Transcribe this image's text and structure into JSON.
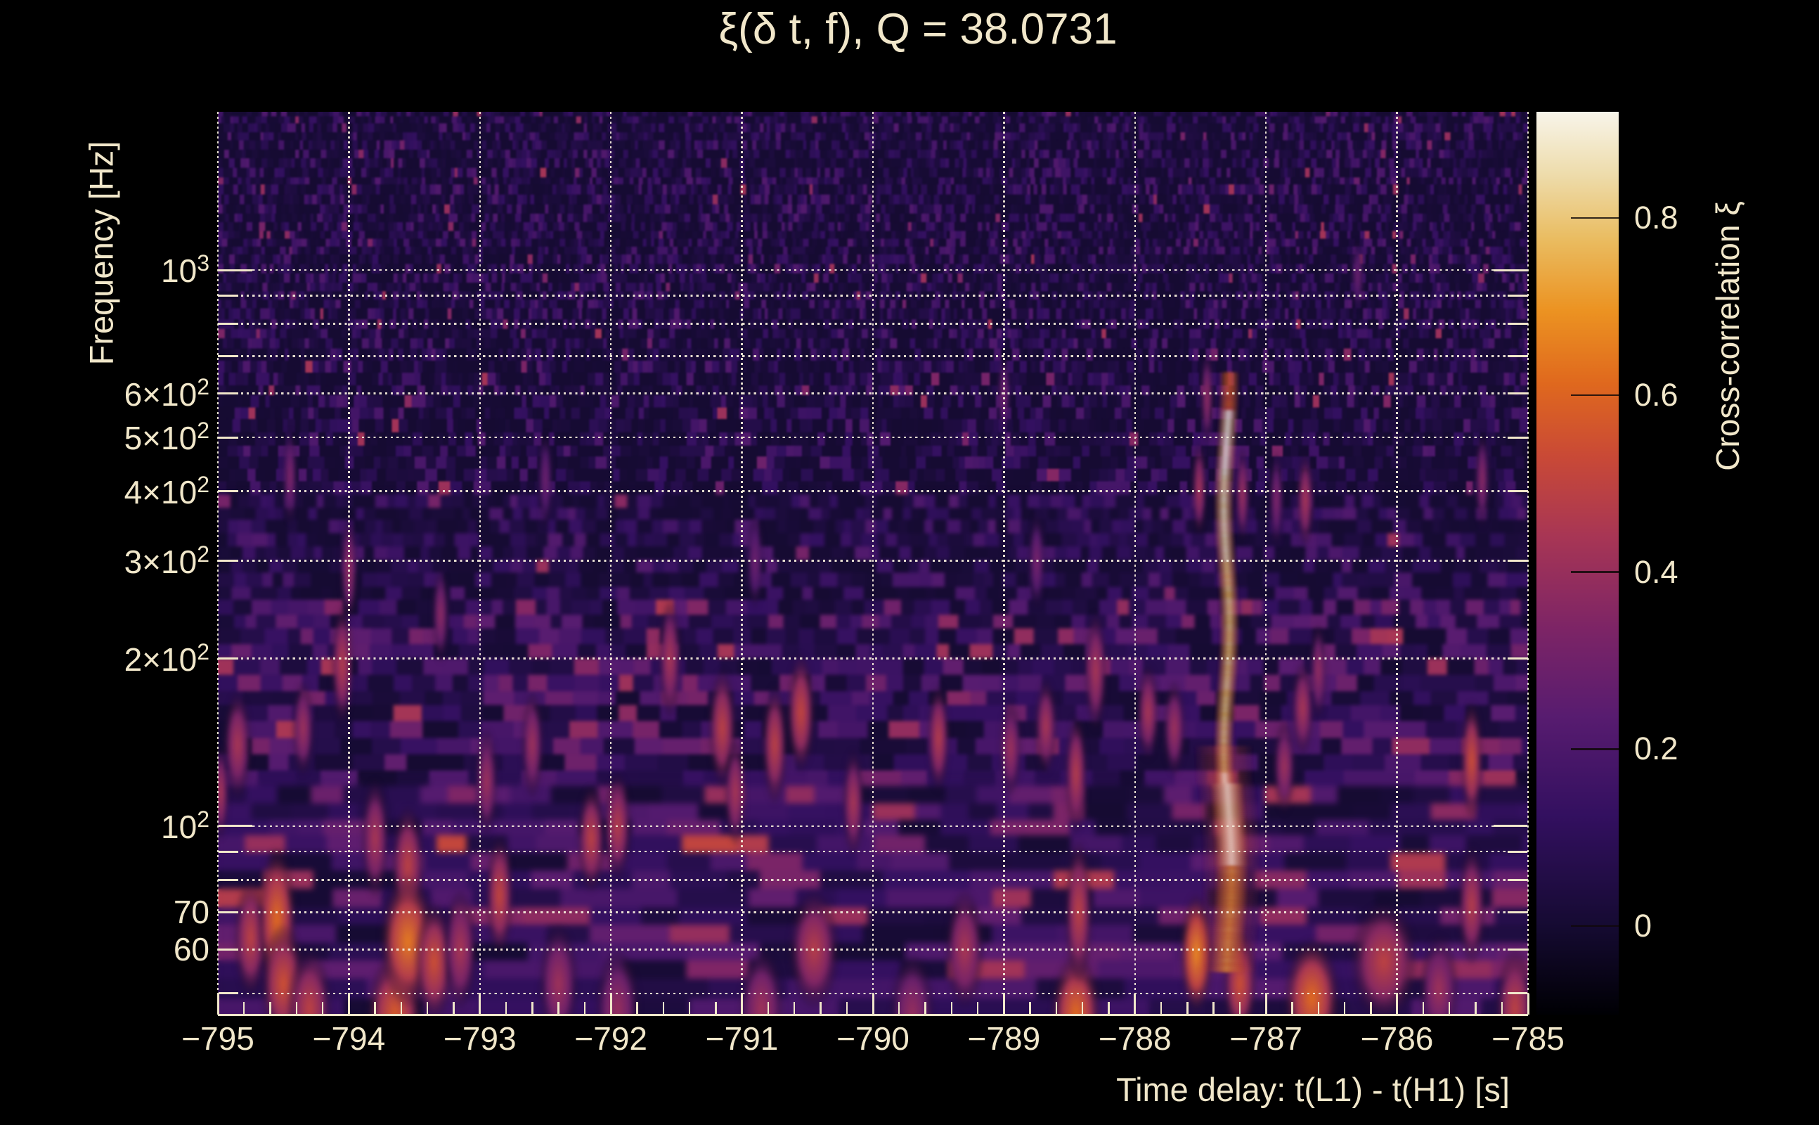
{
  "title": "ξ(δ t, f), Q = 38.0731",
  "colors": {
    "background": "#000000",
    "text": "#f1e7ca",
    "grid": "#f7efdc"
  },
  "axes": {
    "x": {
      "title": "Time delay: t(L1) - t(H1) [s]",
      "range": [
        -795,
        -785
      ],
      "minor_tick_step": 0.2,
      "ticks": [
        {
          "value": -795,
          "label": "−795"
        },
        {
          "value": -794,
          "label": "−794"
        },
        {
          "value": -793,
          "label": "−793"
        },
        {
          "value": -792,
          "label": "−792"
        },
        {
          "value": -791,
          "label": "−791"
        },
        {
          "value": -790,
          "label": "−790"
        },
        {
          "value": -789,
          "label": "−789"
        },
        {
          "value": -788,
          "label": "−788"
        },
        {
          "value": -787,
          "label": "−787"
        },
        {
          "value": -786,
          "label": "−786"
        },
        {
          "value": -785,
          "label": "−785"
        }
      ]
    },
    "y": {
      "title": "Frequency [Hz]",
      "scale": "log",
      "range_hz": [
        45.8,
        1926
      ],
      "gridlines_hz": [
        50,
        60,
        70,
        80,
        90,
        100,
        200,
        300,
        400,
        500,
        600,
        700,
        800,
        900,
        1000
      ],
      "ticks": [
        {
          "value": 1000,
          "base": "10",
          "sup": "3"
        },
        {
          "value": 600,
          "base": "6×10",
          "sup": "2"
        },
        {
          "value": 500,
          "base": "5×10",
          "sup": "2"
        },
        {
          "value": 400,
          "base": "4×10",
          "sup": "2"
        },
        {
          "value": 300,
          "base": "3×10",
          "sup": "2"
        },
        {
          "value": 200,
          "base": "2×10",
          "sup": "2"
        },
        {
          "value": 100,
          "base": "10",
          "sup": "2"
        },
        {
          "value": 70,
          "base": "70",
          "sup": ""
        },
        {
          "value": 60,
          "base": "60",
          "sup": ""
        }
      ]
    },
    "colorbar": {
      "title": "Cross-correlation ξ",
      "range": [
        -0.1,
        0.92
      ],
      "ticks": [
        {
          "value": 0.8,
          "label": "0.8"
        },
        {
          "value": 0.6,
          "label": "0.6"
        },
        {
          "value": 0.4,
          "label": "0.4"
        },
        {
          "value": 0.2,
          "label": "0.2"
        },
        {
          "value": 0,
          "label": "0"
        }
      ]
    }
  },
  "chart_data": {
    "type": "heatmap",
    "title": "ξ(δ t, f), Q = 38.0731",
    "q_value": 38.0731,
    "xlabel": "Time delay: t(L1) - t(H1) [s]",
    "ylabel": "Frequency [Hz]",
    "zlabel": "Cross-correlation ξ",
    "x_range": [
      -795,
      -785
    ],
    "y_range_hz": [
      45.8,
      1926
    ],
    "y_scale": "log",
    "z_range": [
      -0.1,
      0.92
    ],
    "legend_position": "right-colorbar",
    "grid": "dotted-white-at-decade-subdivisions",
    "colormap_stops": [
      [
        0.0,
        "#000004"
      ],
      [
        0.1,
        "#160b33"
      ],
      [
        0.22,
        "#331060"
      ],
      [
        0.33,
        "#581c70"
      ],
      [
        0.43,
        "#7e2566"
      ],
      [
        0.53,
        "#a83655"
      ],
      [
        0.62,
        "#ca4a36"
      ],
      [
        0.7,
        "#e0691e"
      ],
      [
        0.78,
        "#ec9322"
      ],
      [
        0.86,
        "#eabd62"
      ],
      [
        0.93,
        "#eedcab"
      ],
      [
        1.0,
        "#f8f5ea"
      ]
    ],
    "noise": {
      "seed": 1234,
      "base_level": 0.1,
      "low_freq_boost": 0.3,
      "texture": "fine-vertical-striations-above-600Hz, coarse-blobs-below-200Hz"
    },
    "streak": {
      "t": -787.3,
      "f_min": 55,
      "f_max": 660,
      "width_s": 0.035,
      "segments": [
        [
          55,
          85,
          0.7
        ],
        [
          85,
          125,
          0.95
        ],
        [
          125,
          300,
          0.8
        ],
        [
          300,
          430,
          0.87
        ],
        [
          430,
          560,
          0.94
        ],
        [
          560,
          660,
          0.55
        ]
      ]
    },
    "blobs": [
      [
        -794.98,
        115,
        0.45,
        0.03,
        0.04
      ],
      [
        -794.85,
        140,
        0.45,
        0.05,
        0.045
      ],
      [
        -794.75,
        63,
        0.5,
        0.06,
        0.05
      ],
      [
        -794.55,
        68,
        0.62,
        0.07,
        0.06
      ],
      [
        -794.5,
        52,
        0.55,
        0.08,
        0.05
      ],
      [
        -794.35,
        150,
        0.42,
        0.04,
        0.04
      ],
      [
        -794.3,
        47,
        0.5,
        0.08,
        0.05
      ],
      [
        -794.45,
        425,
        0.35,
        0.025,
        0.04
      ],
      [
        -794.05,
        195,
        0.48,
        0.04,
        0.05
      ],
      [
        -794.0,
        290,
        0.4,
        0.03,
        0.045
      ],
      [
        -793.8,
        95,
        0.45,
        0.05,
        0.05
      ],
      [
        -793.65,
        46,
        0.58,
        0.1,
        0.05
      ],
      [
        -793.55,
        85,
        0.5,
        0.06,
        0.05
      ],
      [
        -793.55,
        62,
        0.65,
        0.1,
        0.055
      ],
      [
        -793.35,
        57,
        0.55,
        0.07,
        0.05
      ],
      [
        -793.3,
        240,
        0.38,
        0.03,
        0.04
      ],
      [
        -793.15,
        60,
        0.45,
        0.06,
        0.05
      ],
      [
        -792.95,
        120,
        0.42,
        0.04,
        0.045
      ],
      [
        -792.85,
        75,
        0.52,
        0.05,
        0.05
      ],
      [
        -792.6,
        140,
        0.42,
        0.04,
        0.045
      ],
      [
        -792.5,
        420,
        0.3,
        0.025,
        0.04
      ],
      [
        -792.4,
        52,
        0.42,
        0.07,
        0.05
      ],
      [
        -792.15,
        95,
        0.5,
        0.05,
        0.045
      ],
      [
        -791.95,
        100,
        0.48,
        0.05,
        0.045
      ],
      [
        -791.95,
        47,
        0.4,
        0.08,
        0.05
      ],
      [
        -791.55,
        200,
        0.45,
        0.04,
        0.05
      ],
      [
        -791.15,
        150,
        0.5,
        0.05,
        0.05
      ],
      [
        -791.05,
        115,
        0.45,
        0.04,
        0.045
      ],
      [
        -790.9,
        300,
        0.3,
        0.03,
        0.04
      ],
      [
        -790.85,
        47,
        0.42,
        0.08,
        0.05
      ],
      [
        -790.75,
        140,
        0.5,
        0.045,
        0.05
      ],
      [
        -790.55,
        160,
        0.52,
        0.05,
        0.05
      ],
      [
        -790.45,
        60,
        0.48,
        0.09,
        0.05
      ],
      [
        -790.15,
        110,
        0.45,
        0.04,
        0.045
      ],
      [
        -789.7,
        46,
        0.4,
        0.08,
        0.05
      ],
      [
        -789.5,
        144,
        0.48,
        0.04,
        0.045
      ],
      [
        -789.3,
        60,
        0.45,
        0.07,
        0.05
      ],
      [
        -789.0,
        600,
        0.33,
        0.02,
        0.035
      ],
      [
        -788.95,
        138,
        0.42,
        0.04,
        0.04
      ],
      [
        -788.75,
        300,
        0.33,
        0.03,
        0.04
      ],
      [
        -788.68,
        151,
        0.45,
        0.04,
        0.04
      ],
      [
        -788.45,
        46,
        0.62,
        0.09,
        0.05
      ],
      [
        -788.43,
        70,
        0.5,
        0.05,
        0.06
      ],
      [
        -788.45,
        124,
        0.48,
        0.04,
        0.05
      ],
      [
        -788.3,
        190,
        0.45,
        0.04,
        0.05
      ],
      [
        -787.9,
        160,
        0.45,
        0.04,
        0.04
      ],
      [
        -787.7,
        150,
        0.42,
        0.04,
        0.04
      ],
      [
        -787.53,
        59,
        0.68,
        0.06,
        0.05
      ],
      [
        -787.51,
        404,
        0.45,
        0.025,
        0.04
      ],
      [
        -787.45,
        590,
        0.4,
        0.022,
        0.04
      ],
      [
        -787.2,
        52,
        0.55,
        0.06,
        0.045
      ],
      [
        -787.18,
        395,
        0.42,
        0.025,
        0.04
      ],
      [
        -786.92,
        387,
        0.35,
        0.025,
        0.04
      ],
      [
        -786.86,
        128,
        0.42,
        0.04,
        0.04
      ],
      [
        -786.72,
        163,
        0.45,
        0.04,
        0.04
      ],
      [
        -786.7,
        386,
        0.45,
        0.03,
        0.04
      ],
      [
        -786.65,
        49,
        0.62,
        0.1,
        0.05
      ],
      [
        -786.6,
        190,
        0.4,
        0.03,
        0.04
      ],
      [
        -786.3,
        980,
        0.3,
        0.015,
        0.03
      ],
      [
        -786.1,
        57,
        0.5,
        0.12,
        0.05
      ],
      [
        -785.68,
        51,
        0.42,
        0.07,
        0.045
      ],
      [
        -785.43,
        131,
        0.55,
        0.04,
        0.05
      ],
      [
        -785.43,
        72,
        0.48,
        0.05,
        0.05
      ],
      [
        -785.35,
        420,
        0.38,
        0.025,
        0.04
      ],
      [
        -785.1,
        47,
        0.5,
        0.07,
        0.05
      ]
    ]
  }
}
